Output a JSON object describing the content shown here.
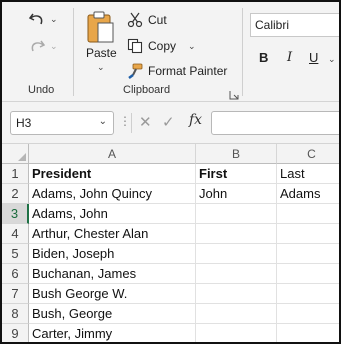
{
  "ribbon": {
    "undo_group": {
      "label": "Undo"
    },
    "clipboard_group": {
      "label": "Clipboard",
      "paste_label": "Paste",
      "cut_label": "Cut",
      "copy_label": "Copy",
      "format_painter_label": "Format Painter"
    },
    "font_group": {
      "font_name": "Calibri",
      "bold_label": "B",
      "italic_label": "I",
      "underline_label": "U"
    }
  },
  "formula_bar": {
    "name_box": "H3",
    "fx_label": "fx",
    "formula": ""
  },
  "sheet": {
    "columns": [
      "A",
      "B",
      "C"
    ],
    "rows": [
      {
        "num": "1",
        "a": "President",
        "b": "First",
        "c": "Last"
      },
      {
        "num": "2",
        "a": "Adams, John Quincy",
        "b": "John",
        "c": "Adams"
      },
      {
        "num": "3",
        "a": "Adams, John",
        "b": "",
        "c": ""
      },
      {
        "num": "4",
        "a": "Arthur, Chester Alan",
        "b": "",
        "c": ""
      },
      {
        "num": "5",
        "a": "Biden, Joseph",
        "b": "",
        "c": ""
      },
      {
        "num": "6",
        "a": "Buchanan, James",
        "b": "",
        "c": ""
      },
      {
        "num": "7",
        "a": "Bush George W.",
        "b": "",
        "c": ""
      },
      {
        "num": "8",
        "a": "Bush, George",
        "b": "",
        "c": ""
      },
      {
        "num": "9",
        "a": "Carter, Jimmy",
        "b": "",
        "c": ""
      }
    ]
  },
  "colors": {
    "accent": "#1e7145",
    "ribbon_bg": "#f3f3f3"
  }
}
